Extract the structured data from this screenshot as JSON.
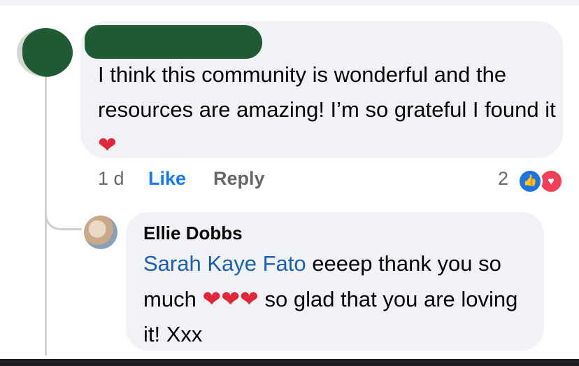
{
  "comment": {
    "text": "I think this community is wonderful and the resources are amazing! I’m so grateful I found it",
    "emoji": "❤",
    "time": "1 d",
    "like_label": "Like",
    "reply_label": "Reply",
    "reaction_count": "2",
    "reactions": [
      "like-icon",
      "love-icon"
    ]
  },
  "reply": {
    "author": "Ellie Dobbs",
    "mention": "Sarah Kaye Fato",
    "text_part1": " eeeep thank you so much ",
    "hearts": "❤❤❤",
    "text_part2": " so glad that you are loving it! Xxx"
  },
  "colors": {
    "bubble": "#f0f2f5",
    "link_blue": "#1877f2",
    "mention_blue": "#1b5fb5",
    "redaction": "#1e5a32"
  }
}
